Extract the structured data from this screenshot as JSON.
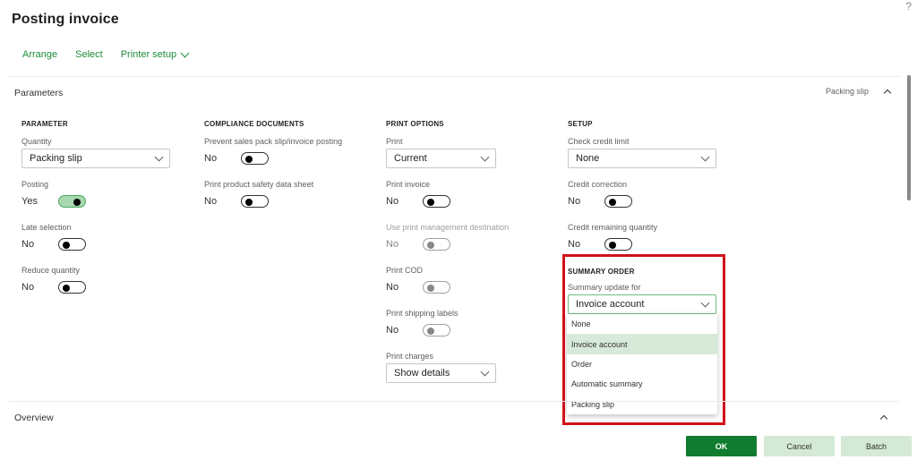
{
  "help_label": "?",
  "title": "Posting invoice",
  "actions": {
    "arrange": "Arrange",
    "select": "Select",
    "printer_setup": "Printer setup"
  },
  "parameters_section": {
    "title": "Parameters",
    "summary": "Packing slip",
    "columns": {
      "parameter": {
        "heading": "PARAMETER",
        "quantity_label": "Quantity",
        "quantity_value": "Packing slip",
        "posting_label": "Posting",
        "posting_value": "Yes",
        "posting_on": true,
        "late_selection_label": "Late selection",
        "late_selection_value": "No",
        "reduce_quantity_label": "Reduce quantity",
        "reduce_quantity_value": "No"
      },
      "compliance": {
        "heading": "COMPLIANCE DOCUMENTS",
        "prevent_label": "Prevent sales pack slip/invoice posting",
        "prevent_value": "No",
        "safety_label": "Print product safety data sheet",
        "safety_value": "No"
      },
      "print_options": {
        "heading": "PRINT OPTIONS",
        "print_label": "Print",
        "print_value": "Current",
        "print_invoice_label": "Print invoice",
        "print_invoice_value": "No",
        "print_mgmt_label": "Use print management destination",
        "print_mgmt_value": "No",
        "print_cod_label": "Print COD",
        "print_cod_value": "No",
        "print_shipping_label": "Print shipping labels",
        "print_shipping_value": "No",
        "print_charges_label": "Print charges",
        "print_charges_value": "Show details"
      },
      "setup": {
        "heading": "SETUP",
        "check_credit_label": "Check credit limit",
        "check_credit_value": "None",
        "credit_correction_label": "Credit correction",
        "credit_correction_value": "No",
        "credit_remaining_label": "Credit remaining quantity",
        "credit_remaining_value": "No"
      },
      "summary_order": {
        "heading": "SUMMARY ORDER",
        "summary_update_label": "Summary update for",
        "summary_update_value": "Invoice account",
        "options": [
          "None",
          "Invoice account",
          "Order",
          "Automatic summary",
          "Packing slip"
        ],
        "selected_index": 1
      }
    }
  },
  "overview_section": {
    "title": "Overview"
  },
  "footer": {
    "ok": "OK",
    "cancel": "Cancel",
    "batch": "Batch"
  },
  "colors": {
    "accent": "#107c2f",
    "link": "#1f8a3a",
    "highlight_border": "#d0121b",
    "selected_option": "#d7ead9"
  }
}
